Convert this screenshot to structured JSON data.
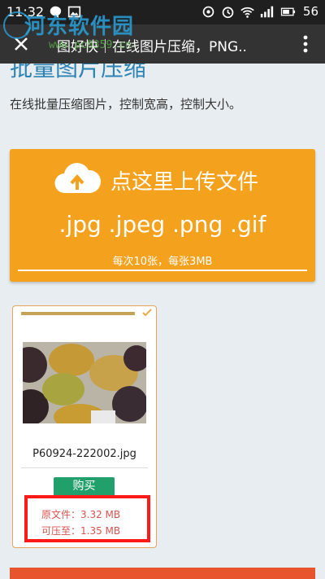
{
  "status_bar": {
    "time": "11:32",
    "battery": "56",
    "left_icons": [
      "chat-icon",
      "image-icon"
    ],
    "right_icons": [
      "camera-rotate-icon",
      "alarm-icon",
      "wifi-icon",
      "signal-icon",
      "battery-icon"
    ]
  },
  "app_bar": {
    "title": "图好快｜在线图片压缩，PNG..",
    "close_icon": "close-icon",
    "menu_icon": "more-vert-icon"
  },
  "watermark": {
    "text": "河东软件园",
    "sub": "www.pc0359.cn"
  },
  "page": {
    "heading": "批量图片压缩",
    "subtitle": "在线批量压缩图片，控制宽高，控制大小。"
  },
  "upload": {
    "label": "点这里上传文件",
    "formats": ".jpg .jpeg .png .gif",
    "limit": "每次10张，每张3MB",
    "icon": "cloud-upload-icon",
    "color": "#f4a11d"
  },
  "file": {
    "filename": "P60924-222002.jpg",
    "buy_label": "购买",
    "original_size": "原文件：3.32 MB",
    "compressed_size": "可压至：1.35 MB",
    "progress": 1.0,
    "status_icon": "check-icon"
  },
  "colors": {
    "accent": "#f4a11d",
    "buy": "#22a06b",
    "size_text": "#d9534f",
    "highlight": "#ff1a1a"
  }
}
